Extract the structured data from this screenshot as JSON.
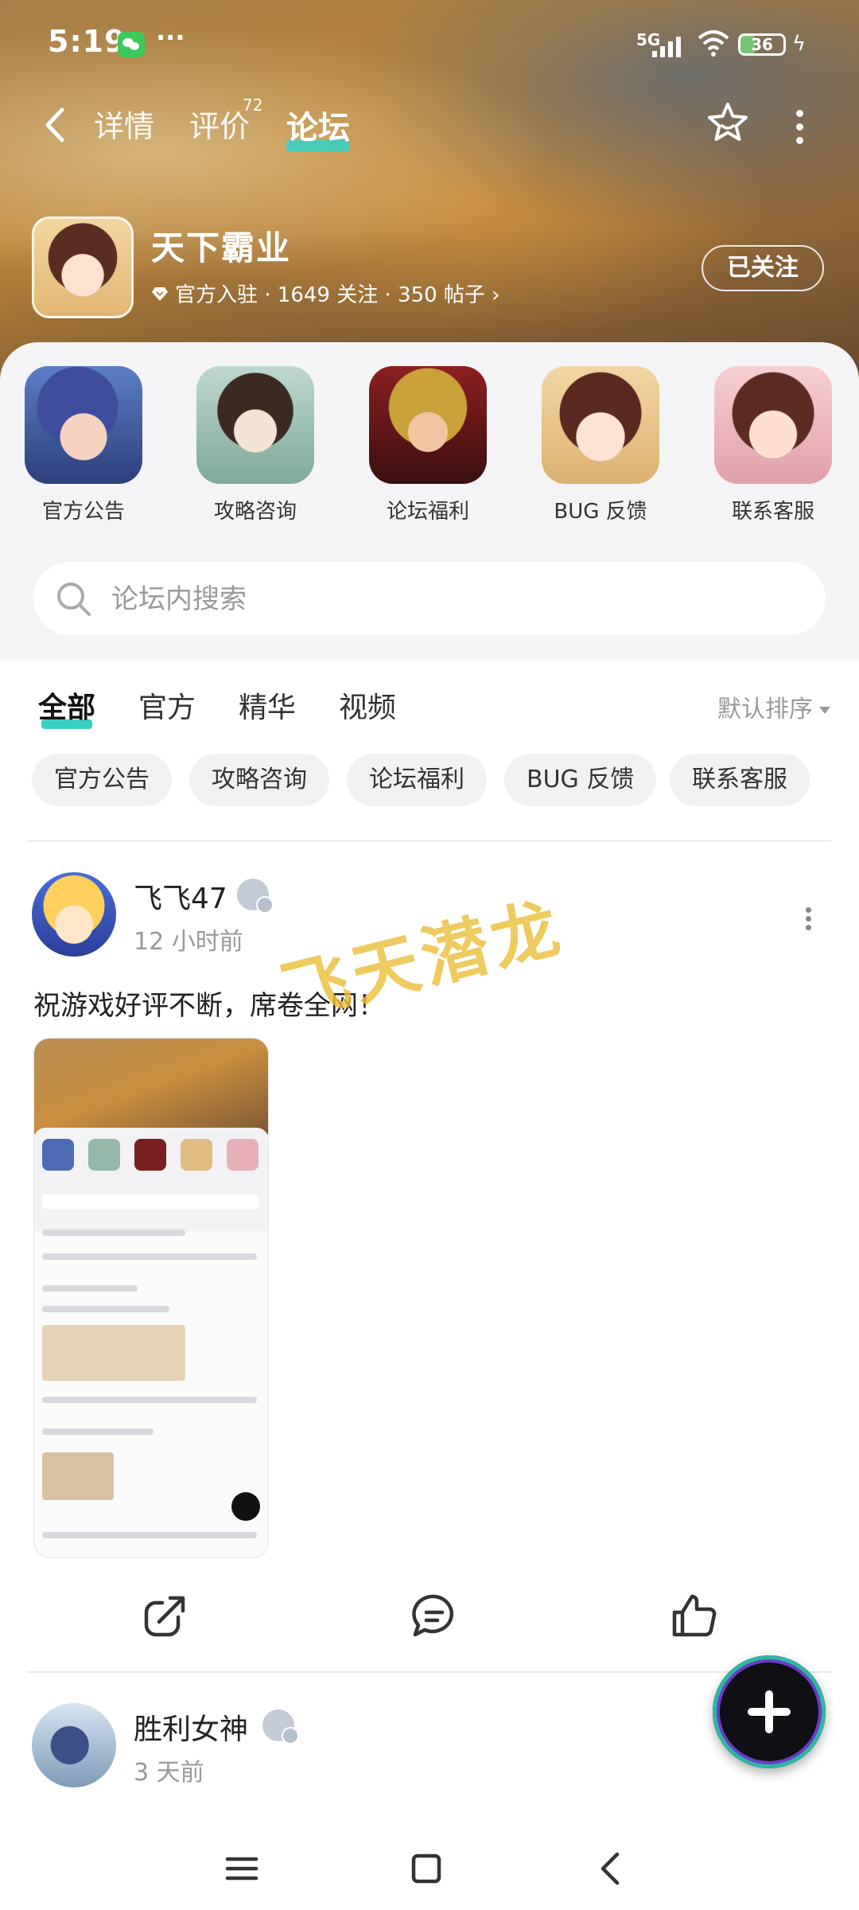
{
  "status_bar": {
    "time": "5:19",
    "dots": "···",
    "network": "5G",
    "battery": "36"
  },
  "nav": {
    "tabs": [
      {
        "label": "详情"
      },
      {
        "label": "评价",
        "count": "72"
      },
      {
        "label": "论坛"
      }
    ],
    "active_tab": "论坛"
  },
  "game": {
    "name": "天下霸业",
    "meta": "官方入驻 · 1649 关注 · 350 帖子 ›",
    "follow_label": "已关注"
  },
  "sections": [
    {
      "label": "官方公告"
    },
    {
      "label": "攻略咨询"
    },
    {
      "label": "论坛福利"
    },
    {
      "label": "BUG 反馈"
    },
    {
      "label": "联系客服"
    }
  ],
  "search": {
    "placeholder": "论坛内搜索"
  },
  "content_tabs": [
    "全部",
    "官方",
    "精华",
    "视频"
  ],
  "sort_label": "默认排序",
  "chips": [
    "官方公告",
    "攻略咨询",
    "论坛福利",
    "BUG 反馈",
    "联系客服"
  ],
  "posts": [
    {
      "user": "飞飞47",
      "time": "12 小时前",
      "text": "祝游戏好评不断，席卷全网！",
      "watermark": "飞天潜龙"
    },
    {
      "user": "胜利女神",
      "time": "3 天前"
    }
  ],
  "icons": {
    "back": "back-arrow-icon",
    "favorite": "star-icon",
    "more": "more-vertical-icon",
    "search": "search-icon",
    "share": "share-icon",
    "comment": "comment-icon",
    "like": "thumbs-up-icon",
    "fab": "plus-icon",
    "nav_menu": "menu-icon",
    "nav_home": "home-square-icon",
    "nav_back": "back-chevron-icon"
  },
  "colors": {
    "accent": "#3ad0c0",
    "fab_ring": "#6a3cc8"
  }
}
